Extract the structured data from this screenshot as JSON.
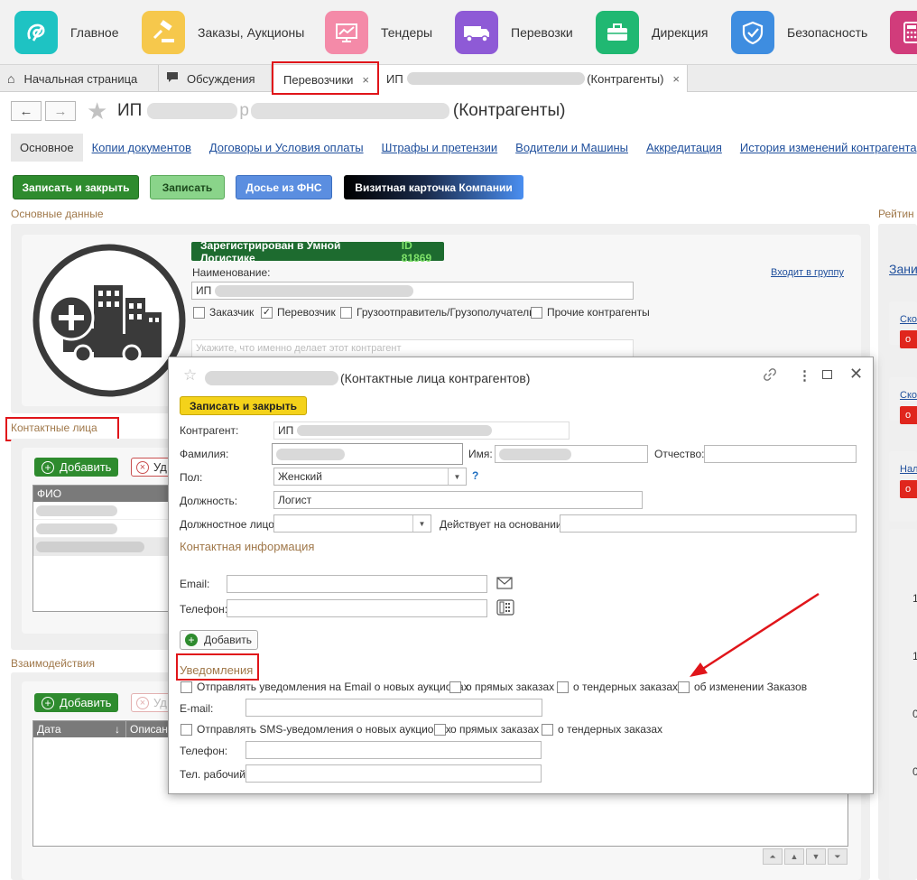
{
  "sections": [
    {
      "label": "Главное",
      "icon": "logo-swirl-icon",
      "color": "#1ec3c3"
    },
    {
      "label": "Заказы, Аукционы",
      "icon": "auction-gavel-icon",
      "color": "#f6c84c"
    },
    {
      "label": "Тендеры",
      "icon": "chart-monitor-icon",
      "color": "#f48aa8"
    },
    {
      "label": "Перевозки",
      "icon": "truck-icon",
      "color": "#8e5ad6"
    },
    {
      "label": "Дирекция",
      "icon": "briefcase-icon",
      "color": "#20b872"
    },
    {
      "label": "Безопасность",
      "icon": "shield-icon",
      "color": "#3e8de0"
    },
    {
      "label": "",
      "icon": "calculator-icon",
      "color": "#d13c7b"
    }
  ],
  "tabs": {
    "home": "Начальная страница",
    "discussions": "Обсуждения",
    "carriers": "Перевозчики",
    "ip_prefix": "ИП",
    "ip_suffix": "(Контрагенты)",
    "close": "×"
  },
  "header": {
    "back": "←",
    "forward": "→",
    "star": "★",
    "title_prefix": "ИП",
    "title_mid": "р",
    "title_suffix": "(Контрагенты)"
  },
  "subnav": [
    "Основное",
    "Копии документов",
    "Договоры и Условия оплаты",
    "Штрафы и претензии",
    "Водители и Машины",
    "Аккредитация",
    "История изменений контрагента"
  ],
  "actions": {
    "save_close": "Записать и закрыть",
    "save": "Записать",
    "dossier": "Досье из ФНС",
    "business_card": "Визитная карточка Компании"
  },
  "main": {
    "basic_caption": "Основные данные",
    "rating_caption": "Рейтин",
    "registered_badge": "Зарегистрирован в Умной Логистике",
    "id_label": "ID 81869",
    "name_label": "Наименование:",
    "name_prefix": "ИП",
    "group_link": "Входит в группу",
    "roles": [
      {
        "label": "Заказчик",
        "checked": false
      },
      {
        "label": "Перевозчик",
        "checked": true
      },
      {
        "label": "Грузоотправитель/Грузополучатель",
        "checked": false
      },
      {
        "label": "Прочие контрагенты",
        "checked": false
      }
    ],
    "activity_placeholder": "Укажите, что именно делает этот контрагент",
    "contacts_caption": "Контактные лица",
    "add_label": "Добавить",
    "delete_label": "Уд",
    "fio_header": "ФИО",
    "interactions_caption": "Взаимодействия",
    "date_header": "Дата",
    "sort_arrow": "↓",
    "descr_header": "Описан"
  },
  "rating": {
    "link1": "Зани",
    "link2": "Ско",
    "link3": "Ско",
    "link4": "Нал",
    "badge": "о",
    "nums": [
      "1",
      "1",
      "0",
      "0"
    ]
  },
  "dialog": {
    "title": "(Контактные лица контрагентов)",
    "save_close": "Записать и закрыть",
    "counterparty_label": "Контрагент:",
    "counterparty_prefix": "ИП",
    "surname_label": "Фамилия:",
    "name_label": "Имя:",
    "patronymic_label": "Отчество:",
    "gender_label": "Пол:",
    "gender_value": "Женский",
    "help": "?",
    "position_label": "Должность:",
    "position_value": "Логист",
    "official_label": "Должностное лицо:",
    "basis_label": "Действует на основании:",
    "contact_info_caption": "Контактная информация",
    "email_label": "Email:",
    "phone_label": "Телефон:",
    "add_label": "Добавить",
    "notifications_caption": "Уведомления",
    "email_notify": "Отправлять уведомления на Email о новых аукционах",
    "direct_orders": "о прямых заказах",
    "tender_orders": "о тендерных заказах",
    "order_changes": "об изменении Заказов",
    "email2_label": "E-mail:",
    "sms_notify": "Отправлять SMS-уведомления о новых аукционах",
    "phone2_label": "Телефон:",
    "work_phone_label": "Тел. рабочий:"
  },
  "colors": {
    "highlight": "#e0151a",
    "green": "#2e8b2e",
    "blue": "#5b8ee0",
    "yellow": "#f4d21a",
    "caption": "#a0784a",
    "link": "#1f4f9c"
  }
}
